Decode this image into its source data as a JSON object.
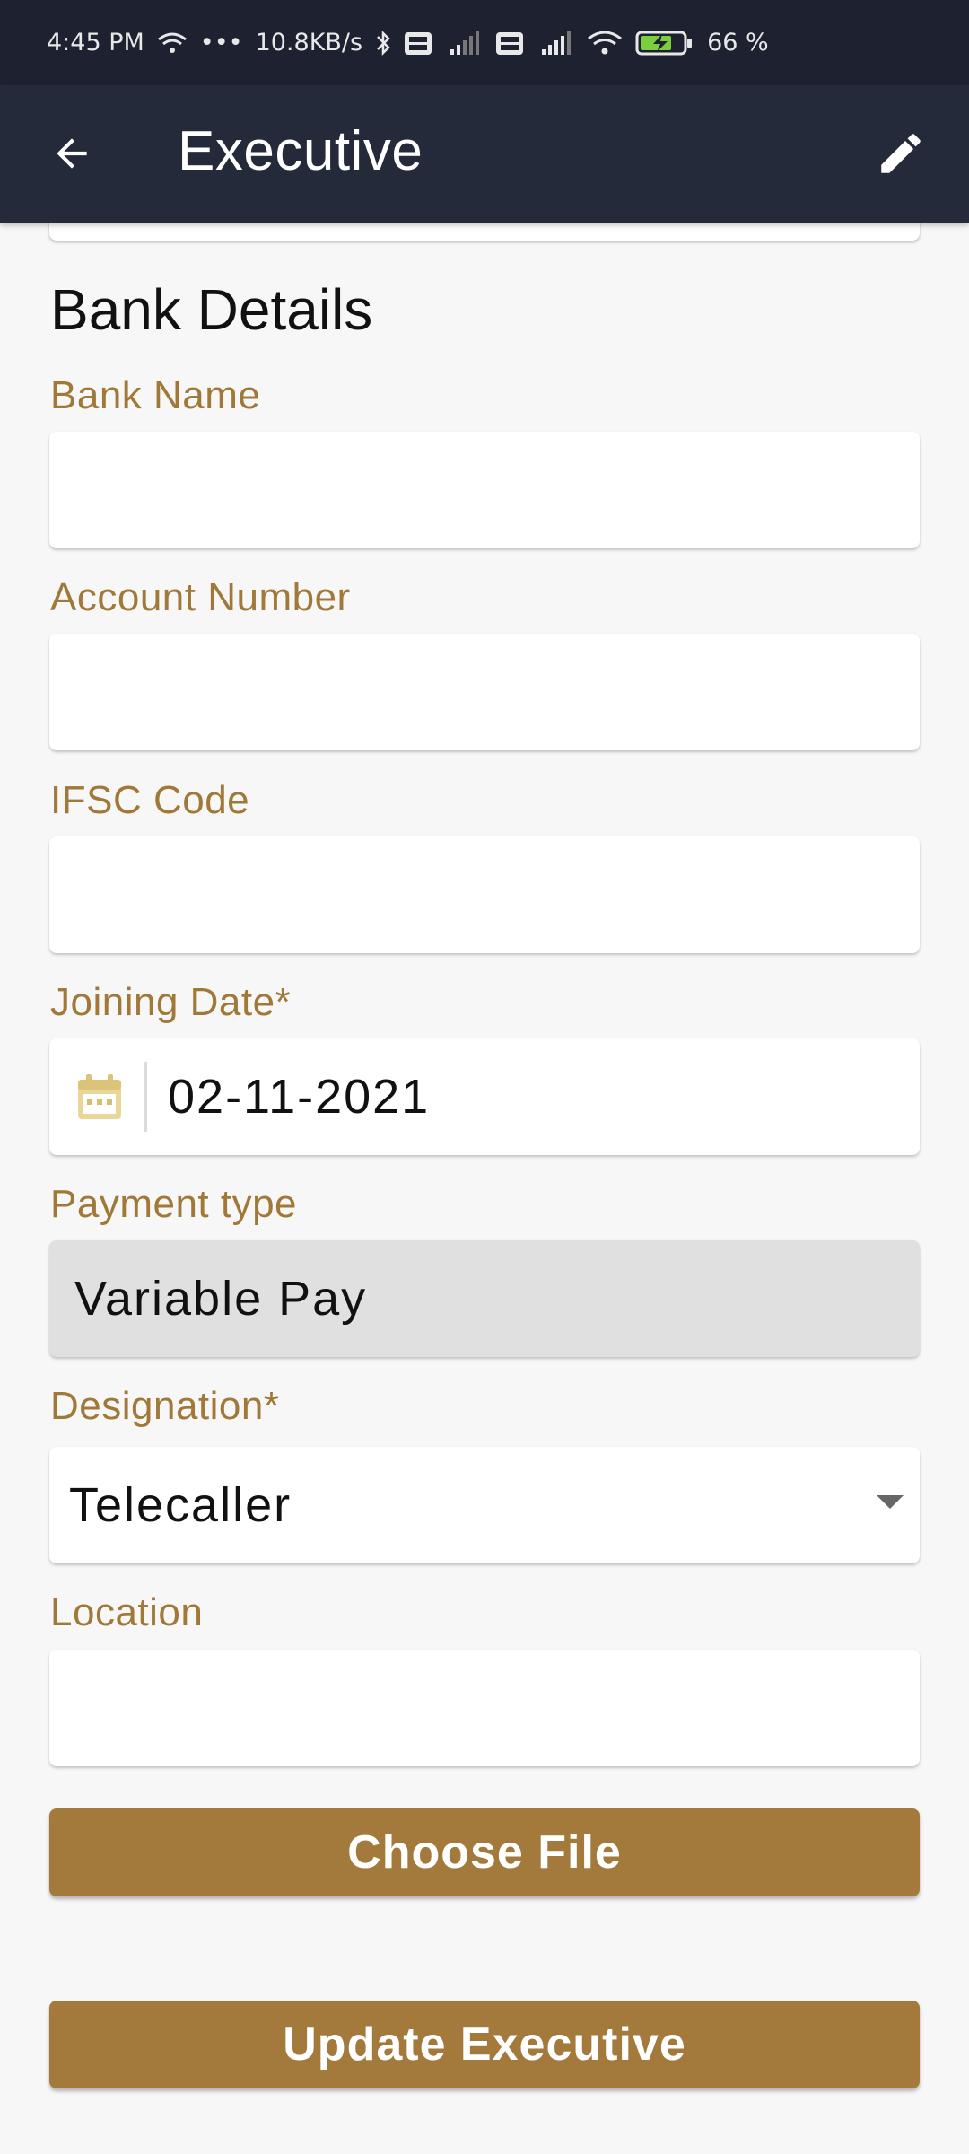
{
  "status_bar": {
    "time": "4:45 PM",
    "dots": "•••",
    "speed": "10.8KB/s",
    "battery": "66 %"
  },
  "app_bar": {
    "title": "Executive",
    "back_icon": "arrow-back-icon",
    "edit_icon": "pencil-icon"
  },
  "section": {
    "title": "Bank Details"
  },
  "fields": {
    "bank_name": {
      "label": "Bank Name",
      "value": ""
    },
    "account_number": {
      "label": "Account Number",
      "value": ""
    },
    "ifsc_code": {
      "label": "IFSC Code",
      "value": ""
    },
    "joining_date": {
      "label": "Joining Date*",
      "value": "02-11-2021"
    },
    "payment_type": {
      "label": "Payment type",
      "value": "Variable Pay"
    },
    "designation": {
      "label": "Designation*",
      "value": "Telecaller"
    },
    "location": {
      "label": "Location",
      "value": ""
    }
  },
  "buttons": {
    "choose_file": "Choose File",
    "update_executive": "Update Executive"
  },
  "colors": {
    "app_bar_bg": "#252a3a",
    "label": "#a07838",
    "accent_button": "#a37a3c"
  }
}
